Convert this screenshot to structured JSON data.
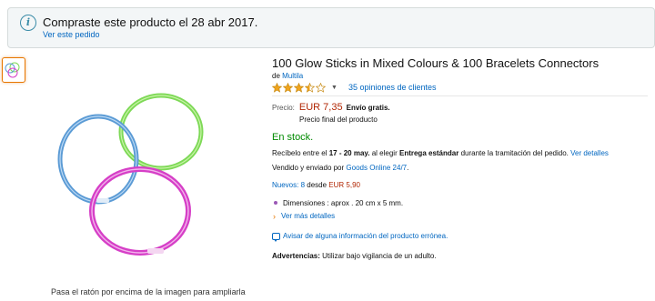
{
  "notice": {
    "text": "Compraste este producto el 28 abr 2017.",
    "link": "Ver este pedido",
    "icon": "info-icon"
  },
  "gallery": {
    "thumbnail_icon": "glow-bracelets-thumbnail",
    "main_image": "glow-bracelets-image",
    "caption": "Pasa el ratón por encima de la imagen para ampliarla",
    "bracelet_colors": [
      "#7ed957",
      "#5b9bd5",
      "#d63fc7"
    ]
  },
  "product": {
    "title": "100 Glow Sticks in Mixed Colours & 100 Bracelets Connectors",
    "by_prefix": "de",
    "brand": "Multila",
    "rating": 3.5,
    "rating_max": 5,
    "reviews": "35 opiniones de clientes"
  },
  "price": {
    "label": "Precio:",
    "value": "EUR 7,35",
    "shipping": "Envío gratis.",
    "note": "Precio final del producto"
  },
  "stock": "En stock.",
  "delivery": {
    "part1": "Recíbelo entre el",
    "dates": "17 - 20 may.",
    "part2": "al elegir",
    "method": "Entrega estándar",
    "part3": "durante la tramitación del pedido.",
    "details_link": "Ver detalles"
  },
  "seller": {
    "prefix": "Vendido y enviado por",
    "name": "Goods Online 24/7",
    "suffix": "."
  },
  "offers": {
    "label": "Nuevos: 8",
    "from": "desde",
    "price": "EUR 5,90"
  },
  "bullets": [
    "Dimensiones : aprox . 20 cm x 5 mm."
  ],
  "more_details": "Ver más detalles",
  "report_link": "Avisar de alguna información del producto errónea.",
  "warning": {
    "label": "Advertencias:",
    "text": "Utilizar bajo vigilancia de un adulto."
  },
  "colors": {
    "link": "#0066c0",
    "price": "#b12704",
    "stock": "#008a00",
    "star": "#f0a41d",
    "thumb_border": "#e77600"
  }
}
